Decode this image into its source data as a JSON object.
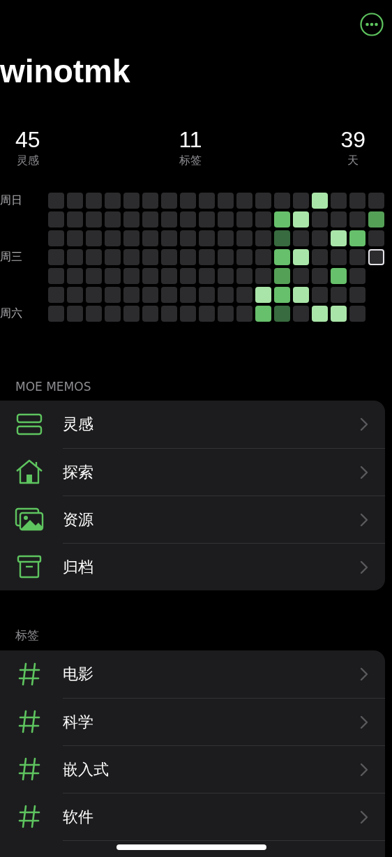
{
  "user": {
    "name": "winotmk"
  },
  "stats": [
    {
      "value": "45",
      "label": "灵感"
    },
    {
      "value": "11",
      "label": "标签"
    },
    {
      "value": "39",
      "label": "天"
    }
  ],
  "heatmap": {
    "day_labels": [
      "周日",
      "周三",
      "周六"
    ],
    "weeks": [
      [
        {
          "color": "#2c2c2e",
          "today": false
        },
        {
          "color": "#2c2c2e",
          "today": false
        },
        {
          "color": "#2c2c2e",
          "today": false
        },
        {
          "color": "#2c2c2e",
          "today": false
        },
        {
          "color": "#2c2c2e",
          "today": false
        },
        {
          "color": "#2c2c2e",
          "today": false
        },
        {
          "color": "#2c2c2e",
          "today": false
        }
      ],
      [
        {
          "color": "#2c2c2e",
          "today": false
        },
        {
          "color": "#2c2c2e",
          "today": false
        },
        {
          "color": "#2c2c2e",
          "today": false
        },
        {
          "color": "#2c2c2e",
          "today": false
        },
        {
          "color": "#2c2c2e",
          "today": false
        },
        {
          "color": "#2c2c2e",
          "today": false
        },
        {
          "color": "#2c2c2e",
          "today": false
        }
      ],
      [
        {
          "color": "#2c2c2e",
          "today": false
        },
        {
          "color": "#2c2c2e",
          "today": false
        },
        {
          "color": "#2c2c2e",
          "today": false
        },
        {
          "color": "#2c2c2e",
          "today": false
        },
        {
          "color": "#2c2c2e",
          "today": false
        },
        {
          "color": "#2c2c2e",
          "today": false
        },
        {
          "color": "#2c2c2e",
          "today": false
        }
      ],
      [
        {
          "color": "#2c2c2e",
          "today": false
        },
        {
          "color": "#2c2c2e",
          "today": false
        },
        {
          "color": "#2c2c2e",
          "today": false
        },
        {
          "color": "#2c2c2e",
          "today": false
        },
        {
          "color": "#2c2c2e",
          "today": false
        },
        {
          "color": "#2c2c2e",
          "today": false
        },
        {
          "color": "#2c2c2e",
          "today": false
        }
      ],
      [
        {
          "color": "#2c2c2e",
          "today": false
        },
        {
          "color": "#2c2c2e",
          "today": false
        },
        {
          "color": "#2c2c2e",
          "today": false
        },
        {
          "color": "#2c2c2e",
          "today": false
        },
        {
          "color": "#2c2c2e",
          "today": false
        },
        {
          "color": "#2c2c2e",
          "today": false
        },
        {
          "color": "#2c2c2e",
          "today": false
        }
      ],
      [
        {
          "color": "#2c2c2e",
          "today": false
        },
        {
          "color": "#2c2c2e",
          "today": false
        },
        {
          "color": "#2c2c2e",
          "today": false
        },
        {
          "color": "#2c2c2e",
          "today": false
        },
        {
          "color": "#2c2c2e",
          "today": false
        },
        {
          "color": "#2c2c2e",
          "today": false
        },
        {
          "color": "#2c2c2e",
          "today": false
        }
      ],
      [
        {
          "color": "#2c2c2e",
          "today": false
        },
        {
          "color": "#2c2c2e",
          "today": false
        },
        {
          "color": "#2c2c2e",
          "today": false
        },
        {
          "color": "#2c2c2e",
          "today": false
        },
        {
          "color": "#2c2c2e",
          "today": false
        },
        {
          "color": "#2c2c2e",
          "today": false
        },
        {
          "color": "#2c2c2e",
          "today": false
        }
      ],
      [
        {
          "color": "#2c2c2e",
          "today": false
        },
        {
          "color": "#2c2c2e",
          "today": false
        },
        {
          "color": "#2c2c2e",
          "today": false
        },
        {
          "color": "#2c2c2e",
          "today": false
        },
        {
          "color": "#2c2c2e",
          "today": false
        },
        {
          "color": "#2c2c2e",
          "today": false
        },
        {
          "color": "#2c2c2e",
          "today": false
        }
      ],
      [
        {
          "color": "#2c2c2e",
          "today": false
        },
        {
          "color": "#2c2c2e",
          "today": false
        },
        {
          "color": "#2c2c2e",
          "today": false
        },
        {
          "color": "#2c2c2e",
          "today": false
        },
        {
          "color": "#2c2c2e",
          "today": false
        },
        {
          "color": "#2c2c2e",
          "today": false
        },
        {
          "color": "#2c2c2e",
          "today": false
        }
      ],
      [
        {
          "color": "#2c2c2e",
          "today": false
        },
        {
          "color": "#2c2c2e",
          "today": false
        },
        {
          "color": "#2c2c2e",
          "today": false
        },
        {
          "color": "#2c2c2e",
          "today": false
        },
        {
          "color": "#2c2c2e",
          "today": false
        },
        {
          "color": "#2c2c2e",
          "today": false
        },
        {
          "color": "#2c2c2e",
          "today": false
        }
      ],
      [
        {
          "color": "#2c2c2e",
          "today": false
        },
        {
          "color": "#2c2c2e",
          "today": false
        },
        {
          "color": "#2c2c2e",
          "today": false
        },
        {
          "color": "#2c2c2e",
          "today": false
        },
        {
          "color": "#2c2c2e",
          "today": false
        },
        {
          "color": "#2c2c2e",
          "today": false
        },
        {
          "color": "#2c2c2e",
          "today": false
        }
      ],
      [
        {
          "color": "#2c2c2e",
          "today": false
        },
        {
          "color": "#2c2c2e",
          "today": false
        },
        {
          "color": "#2c2c2e",
          "today": false
        },
        {
          "color": "#2c2c2e",
          "today": false
        },
        {
          "color": "#2c2c2e",
          "today": false
        },
        {
          "color": "#a9e5a8",
          "today": false
        },
        {
          "color": "#67c06b",
          "today": false
        }
      ],
      [
        {
          "color": "#2c2c2e",
          "today": false
        },
        {
          "color": "#67c06b",
          "today": false
        },
        {
          "color": "#386b3f",
          "today": false
        },
        {
          "color": "#67c06b",
          "today": false
        },
        {
          "color": "#55a057",
          "today": false
        },
        {
          "color": "#67c06b",
          "today": false
        },
        {
          "color": "#386b3f",
          "today": false
        }
      ],
      [
        {
          "color": "#2c2c2e",
          "today": false
        },
        {
          "color": "#a9e5a8",
          "today": false
        },
        {
          "color": "#2c2c2e",
          "today": false
        },
        {
          "color": "#a9e5a8",
          "today": false
        },
        {
          "color": "#2c2c2e",
          "today": false
        },
        {
          "color": "#a9e5a8",
          "today": false
        },
        {
          "color": "#2c2c2e",
          "today": false
        }
      ],
      [
        {
          "color": "#a9e5a8",
          "today": false
        },
        {
          "color": "#2c2c2e",
          "today": false
        },
        {
          "color": "#2c2c2e",
          "today": false
        },
        {
          "color": "#2c2c2e",
          "today": false
        },
        {
          "color": "#2c2c2e",
          "today": false
        },
        {
          "color": "#2c2c2e",
          "today": false
        },
        {
          "color": "#a9e5a8",
          "today": false
        }
      ],
      [
        {
          "color": "#2c2c2e",
          "today": false
        },
        {
          "color": "#2c2c2e",
          "today": false
        },
        {
          "color": "#a9e5a8",
          "today": false
        },
        {
          "color": "#2c2c2e",
          "today": false
        },
        {
          "color": "#67c06b",
          "today": false
        },
        {
          "color": "#2c2c2e",
          "today": false
        },
        {
          "color": "#a9e5a8",
          "today": false
        }
      ],
      [
        {
          "color": "#2c2c2e",
          "today": false
        },
        {
          "color": "#2c2c2e",
          "today": false
        },
        {
          "color": "#67c06b",
          "today": false
        },
        {
          "color": "#2c2c2e",
          "today": false
        },
        {
          "color": "#2c2c2e",
          "today": false
        },
        {
          "color": "#2c2c2e",
          "today": false
        },
        {
          "color": "#2c2c2e",
          "today": false
        }
      ],
      [
        {
          "color": "#2c2c2e",
          "today": false
        },
        {
          "color": "#55a057",
          "today": false
        },
        {
          "color": "#2c2c2e",
          "today": false
        },
        {
          "color": "#2c2c2e",
          "today": true
        }
      ]
    ]
  },
  "sections": [
    {
      "header": "MOE MEMOS",
      "items": [
        {
          "kind": "memos",
          "label": "灵感"
        },
        {
          "kind": "explore",
          "label": "探索"
        },
        {
          "kind": "resources",
          "label": "资源"
        },
        {
          "kind": "archive",
          "label": "归档"
        }
      ]
    },
    {
      "header": "标签",
      "items": [
        {
          "kind": "tag",
          "label": "电影"
        },
        {
          "kind": "tag",
          "label": "科学"
        },
        {
          "kind": "tag",
          "label": "嵌入式"
        },
        {
          "kind": "tag",
          "label": "软件"
        }
      ]
    }
  ]
}
